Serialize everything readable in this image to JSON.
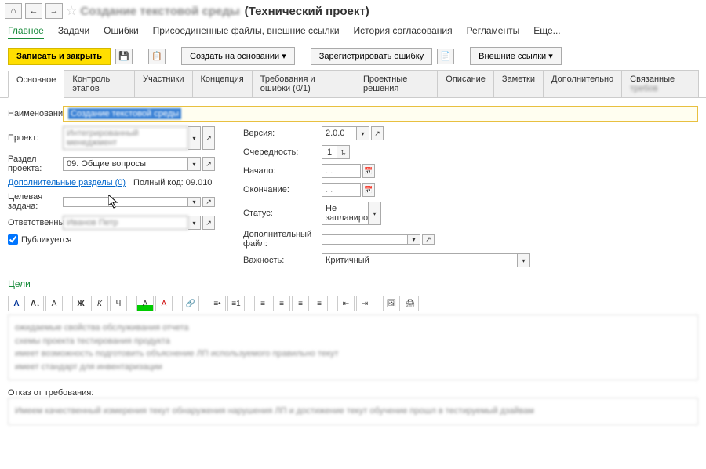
{
  "top": {
    "title_suffix": "(Технический проект)"
  },
  "menu": {
    "main": "Главное",
    "tasks": "Задачи",
    "errors": "Ошибки",
    "attached": "Присоединенные файлы, внешние ссылки",
    "history": "История согласования",
    "reglament": "Регламенты",
    "more": "Еще..."
  },
  "toolbar": {
    "save_close": "Записать и закрыть",
    "create_based": "Создать на основании",
    "register_error": "Зарегистрировать ошибку",
    "ext_links": "Внешние ссылки"
  },
  "tabs": {
    "main": "Основное",
    "stages": "Контроль этапов",
    "participants": "Участники",
    "concept": "Концепция",
    "requirements": "Требования и ошибки (0/1)",
    "decisions": "Проектные решения",
    "description": "Описание",
    "notes": "Заметки",
    "additional": "Дополнительно",
    "related": "Связанные"
  },
  "form": {
    "name_label": "Наименование:",
    "project_label": "Проект:",
    "section_label": "Раздел проекта:",
    "section_value": "09. Общие вопросы",
    "extra_sections": "Дополнительные разделы (0)",
    "full_code_label": "Полный код:",
    "full_code_value": "09.010",
    "target_task_label": "Целевая задача:",
    "responsible_label": "Ответственный:",
    "publish_label": "Публикуется",
    "version_label": "Версия:",
    "version_value": "2.0.0",
    "priority_label": "Очередность:",
    "priority_value": "1",
    "start_label": "Начало:",
    "date_placeholder": ".  .",
    "end_label": "Окончание:",
    "status_label": "Статус:",
    "status_value": "Не запланиро",
    "file_label": "Дополнительный файл:",
    "importance_label": "Важность:",
    "importance_value": "Критичный",
    "goals_title": "Цели",
    "refusal_label": "Отказ от требования:"
  }
}
